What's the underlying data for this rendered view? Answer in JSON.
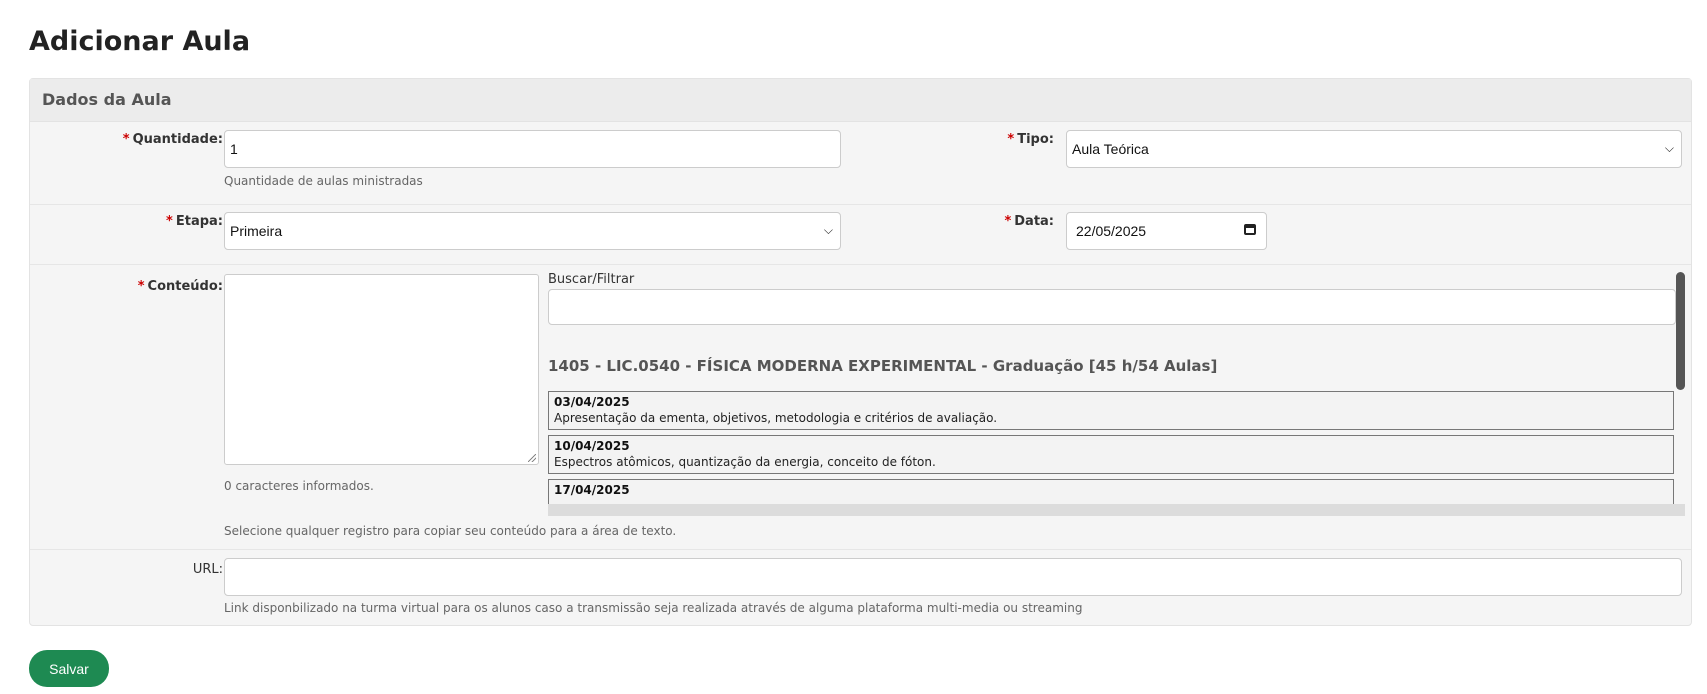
{
  "page": {
    "title": "Adicionar Aula"
  },
  "panel": {
    "title": "Dados da Aula"
  },
  "form": {
    "required_marker": "*",
    "quantidade": {
      "label": "Quantidade:",
      "value": "1",
      "help": "Quantidade de aulas ministradas"
    },
    "tipo": {
      "label": "Tipo:",
      "value": "Aula Teórica"
    },
    "etapa": {
      "label": "Etapa:",
      "value": "Primeira"
    },
    "data": {
      "label": "Data:",
      "value": "22/05/2025"
    },
    "conteudo": {
      "label": "Conteúdo:",
      "value": "",
      "char_count": "0 caracteres informados.",
      "help": "Selecione qualquer registro para copiar seu conteúdo para a área de texto."
    },
    "filter": {
      "label": "Buscar/Filtrar",
      "value": "",
      "group_title": "1405 - LIC.0540 - FÍSICA MODERNA EXPERIMENTAL - Graduação [45 h/54 Aulas]",
      "records": [
        {
          "date": "03/04/2025",
          "text": "Apresentação da ementa, objetivos, metodologia e critérios de avaliação."
        },
        {
          "date": "10/04/2025",
          "text": "Espectros atômicos, quantização da energia, conceito de fóton."
        },
        {
          "date": "17/04/2025",
          "text": ""
        }
      ]
    },
    "url": {
      "label": "URL:",
      "value": "",
      "help": "Link disponbilizado na turma virtual para os alunos caso a transmissão seja realizada através de alguma plataforma multi-media ou streaming"
    }
  },
  "actions": {
    "save_label": "Salvar"
  },
  "colors": {
    "required": "#cc0000",
    "save_button": "#1e8a52"
  },
  "icons": {
    "select_arrow": "chevron-down-icon",
    "date_picker": "calendar-icon"
  }
}
